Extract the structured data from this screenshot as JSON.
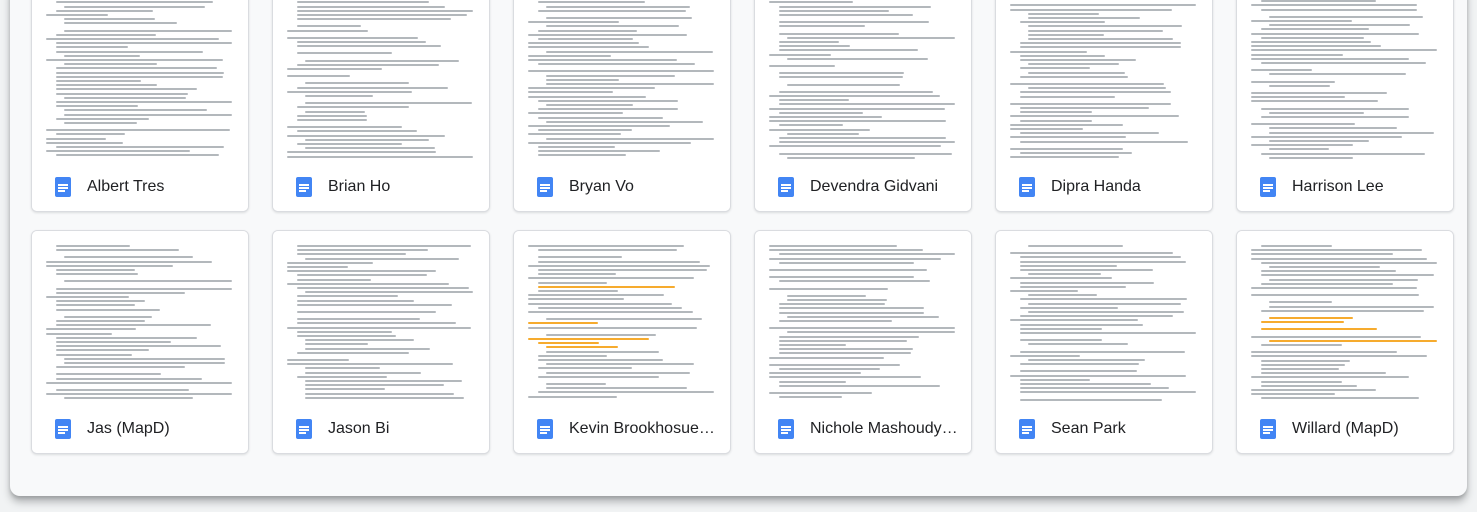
{
  "colors": {
    "doc_icon": "#4285f4",
    "title_text": "#202124",
    "preview_text": "#9aa0a6",
    "highlight": "#f6a623"
  },
  "documents": [
    {
      "title": "Albert Tres",
      "icon": "google-docs-icon"
    },
    {
      "title": "Brian Ho",
      "icon": "google-docs-icon"
    },
    {
      "title": "Bryan Vo",
      "icon": "google-docs-icon"
    },
    {
      "title": "Devendra Gidvani",
      "icon": "google-docs-icon"
    },
    {
      "title": "Dipra Handa",
      "icon": "google-docs-icon"
    },
    {
      "title": "Harrison Lee",
      "icon": "google-docs-icon"
    },
    {
      "title": "Jas (MapD)",
      "icon": "google-docs-icon"
    },
    {
      "title": "Jason Bi",
      "icon": "google-docs-icon"
    },
    {
      "title": "Kevin Brookhosue…",
      "icon": "google-docs-icon"
    },
    {
      "title": "Nichole Mashoudy…",
      "icon": "google-docs-icon"
    },
    {
      "title": "Sean Park",
      "icon": "google-docs-icon"
    },
    {
      "title": "Willard (MapD)",
      "icon": "google-docs-icon"
    }
  ]
}
